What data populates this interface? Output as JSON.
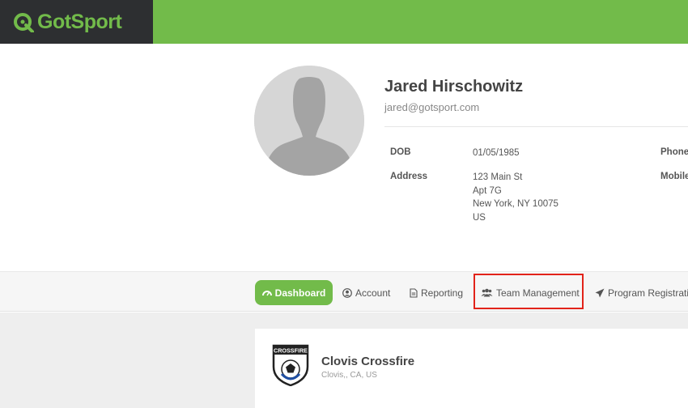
{
  "brand": {
    "name": "GotSport",
    "accent": "#72bb4a",
    "dark": "#2d2f31"
  },
  "profile": {
    "name": "Jared Hirschowitz",
    "email": "jared@gotsport.com",
    "dob_label": "DOB",
    "dob": "01/05/1985",
    "address_label": "Address",
    "address_lines": [
      "123 Main St",
      "Apt 7G",
      "New York, NY 10075",
      "US"
    ],
    "phone_label": "Phone",
    "mobile_label": "Mobile"
  },
  "nav": {
    "items": [
      {
        "label": "Dashboard",
        "icon": "dashboard-icon",
        "active": true
      },
      {
        "label": "Account",
        "icon": "user-circle-icon"
      },
      {
        "label": "Reporting",
        "icon": "document-icon"
      },
      {
        "label": "Team Management",
        "icon": "users-icon",
        "highlighted": true
      },
      {
        "label": "Program Registration",
        "icon": "paper-plane-icon"
      }
    ]
  },
  "club": {
    "name": "Clovis Crossfire",
    "location": "Clovis,, CA, US",
    "logo_text": "CROSSFIRE"
  }
}
